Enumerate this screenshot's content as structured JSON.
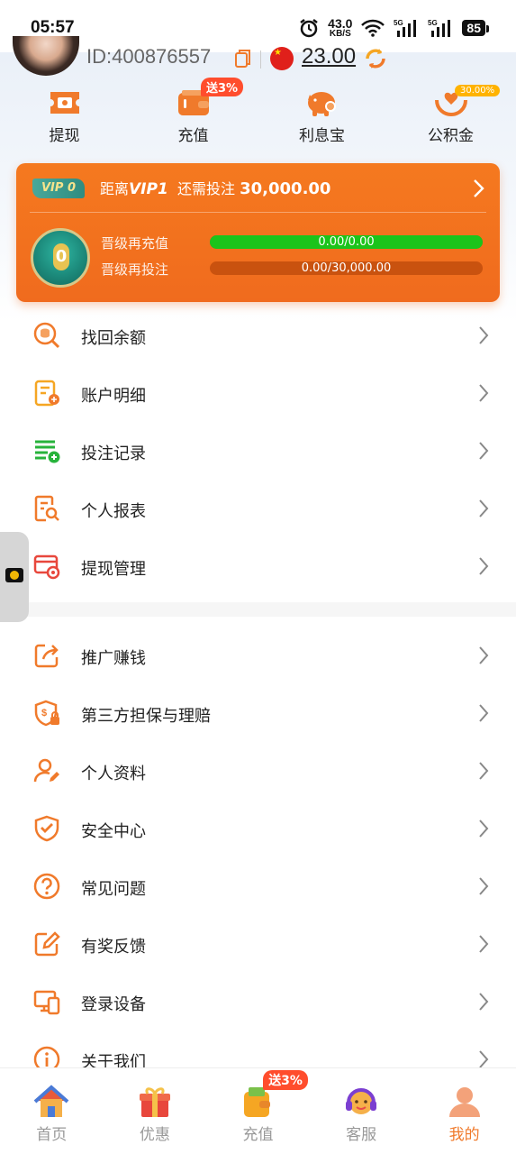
{
  "status_bar": {
    "time": "05:57",
    "net_speed_value": "43.0",
    "net_speed_unit": "KB/S",
    "sig1": "5G",
    "sig2": "5G",
    "battery": "85"
  },
  "profile": {
    "id_label": "ID",
    "id_value": ":400876557",
    "balance": "23.00"
  },
  "quick_actions": [
    {
      "label": "提现",
      "icon": "withdraw-ticket-icon"
    },
    {
      "label": "充值",
      "icon": "wallet-icon",
      "badge": "送3%"
    },
    {
      "label": "利息宝",
      "icon": "piggy-bank-icon"
    },
    {
      "label": "公积金",
      "icon": "hands-fund-icon",
      "badge": "30.00%"
    }
  ],
  "vip": {
    "tag": "VIP 0",
    "dist_prefix": "距离",
    "dist_target": "VIP1",
    "need_prefix": "还需投注",
    "need_amount": "30,000.00",
    "level": "0",
    "progress": [
      {
        "label": "晋级再充值",
        "text": "0.00/0.00",
        "fraction": 1.0
      },
      {
        "label": "晋级再投注",
        "text": "0.00/30,000.00",
        "fraction": 0.0
      }
    ]
  },
  "menu_group1": [
    {
      "label": "找回余额",
      "icon": "recover-balance-icon"
    },
    {
      "label": "账户明细",
      "icon": "account-detail-icon"
    },
    {
      "label": "投注记录",
      "icon": "bet-record-icon"
    },
    {
      "label": "个人报表",
      "icon": "report-search-icon"
    },
    {
      "label": "提现管理",
      "icon": "withdraw-manage-icon"
    }
  ],
  "menu_group2": [
    {
      "label": "推广赚钱",
      "icon": "share-icon"
    },
    {
      "label": "第三方担保与理赔",
      "icon": "guarantee-shield-icon"
    },
    {
      "label": "个人资料",
      "icon": "profile-edit-icon"
    },
    {
      "label": "安全中心",
      "icon": "security-shield-icon"
    },
    {
      "label": "常见问题",
      "icon": "question-icon"
    },
    {
      "label": "有奖反馈",
      "icon": "feedback-edit-icon"
    },
    {
      "label": "登录设备",
      "icon": "devices-icon"
    },
    {
      "label": "关于我们",
      "icon": "info-icon"
    }
  ],
  "tabs": [
    {
      "label": "首页",
      "icon": "home-icon"
    },
    {
      "label": "优惠",
      "icon": "gift-icon"
    },
    {
      "label": "充值",
      "icon": "wallet-icon",
      "badge": "送3%"
    },
    {
      "label": "客服",
      "icon": "headset-icon"
    },
    {
      "label": "我的",
      "icon": "user-icon",
      "active": true
    }
  ],
  "colors": {
    "accent": "#f07a2b",
    "progress_green": "#1bc41b",
    "vip_teal": "#2f8c80"
  }
}
